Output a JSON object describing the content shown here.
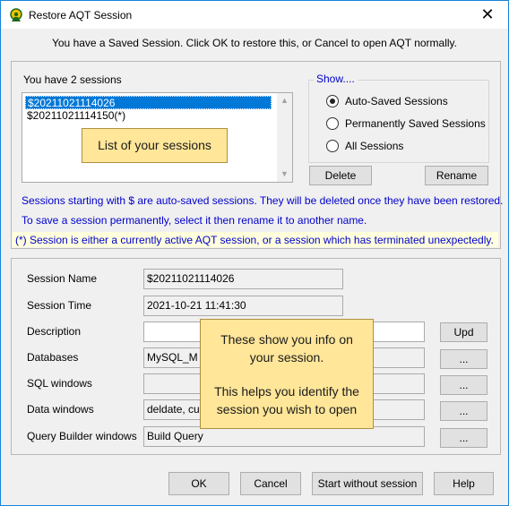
{
  "window": {
    "title": "Restore AQT Session",
    "close_glyph": "✕"
  },
  "intro": "You have a Saved Session. Click OK to restore this, or Cancel to open AQT normally.",
  "sessions": {
    "label": "You have 2 sessions",
    "items": [
      {
        "name": "$20211021114026",
        "selected": true
      },
      {
        "name": "$20211021114150(*)",
        "selected": false
      }
    ]
  },
  "show": {
    "legend": "Show....",
    "options": [
      {
        "label": "Auto-Saved Sessions",
        "selected": true
      },
      {
        "label": "Permanently Saved Sessions",
        "selected": false
      },
      {
        "label": "All Sessions",
        "selected": false
      }
    ]
  },
  "buttons": {
    "delete": "Delete",
    "rename": "Rename",
    "upd": "Upd",
    "ellipsis": "...",
    "ok": "OK",
    "cancel": "Cancel",
    "start_without": "Start without session",
    "help": "Help"
  },
  "info": {
    "line1": "Sessions starting with $ are auto-saved sessions. They will be deleted once they have been restored.",
    "line2": "To save a session permanently, select it then rename it to another name.",
    "line3": "(*) Session is either a currently active AQT session, or a session which has terminated unexpectedly."
  },
  "details": {
    "session_name": {
      "label": "Session Name",
      "value": "$20211021114026"
    },
    "session_time": {
      "label": "Session Time",
      "value": "2021-10-21 11:41:30"
    },
    "description": {
      "label": "Description",
      "value": ""
    },
    "databases": {
      "label": "Databases",
      "value": "MySQL_M ("
    },
    "sql_windows": {
      "label": "SQL windows",
      "value": ""
    },
    "data_windows": {
      "label": "Data windows",
      "value": "deldate, cus"
    },
    "qb_windows": {
      "label": "Query Builder windows",
      "value": "Build Query"
    }
  },
  "callouts": {
    "list": "List of your sessions",
    "info_p1": "These show you info on your session.",
    "info_p2": "This helps you identify the session you wish to open"
  },
  "colors": {
    "accent_blue": "#0000cc",
    "selection": "#0078d7",
    "callout": "#ffe699",
    "warning_bg": "#ffffdd"
  }
}
